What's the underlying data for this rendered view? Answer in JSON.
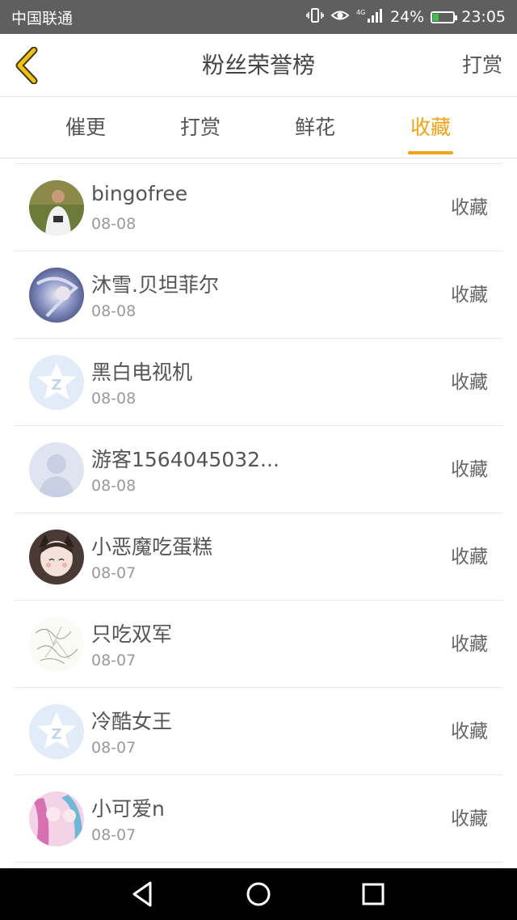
{
  "status_bar": {
    "carrier": "中国联通",
    "network": "4G",
    "battery": "24%",
    "time": "23:05",
    "icons": [
      "vibrate-icon",
      "eye-icon",
      "signal-icon",
      "battery-icon"
    ]
  },
  "header": {
    "title": "粉丝荣誉榜",
    "right_action": "打赏",
    "back_icon": "chevron-left-icon"
  },
  "tabs": [
    {
      "label": "催更",
      "active": false
    },
    {
      "label": "打赏",
      "active": false
    },
    {
      "label": "鲜花",
      "active": false
    },
    {
      "label": "收藏",
      "active": true
    }
  ],
  "list": [
    {
      "name": "bingofree",
      "date": "08-08",
      "action": "收藏",
      "avatar": "photo-avatar"
    },
    {
      "name": "沐雪.贝坦菲尔",
      "date": "08-08",
      "action": "收藏",
      "avatar": "anime-avatar"
    },
    {
      "name": "黑白电视机",
      "date": "08-08",
      "action": "收藏",
      "avatar": "qzone-default-avatar"
    },
    {
      "name": "游客1564045032...",
      "date": "08-08",
      "action": "收藏",
      "avatar": "default-person-avatar"
    },
    {
      "name": "小恶魔吃蛋糕",
      "date": "08-07",
      "action": "收藏",
      "avatar": "anime-avatar"
    },
    {
      "name": "只吃双军",
      "date": "08-07",
      "action": "收藏",
      "avatar": "sketch-avatar"
    },
    {
      "name": "冷酷女王",
      "date": "08-07",
      "action": "收藏",
      "avatar": "qzone-default-avatar"
    },
    {
      "name": "小可爱n",
      "date": "08-07",
      "action": "收藏",
      "avatar": "anime-avatar"
    }
  ],
  "colors": {
    "accent": "#f3a317",
    "status_bar_bg": "#5f5f5f",
    "nav_bar_bg": "#000000",
    "battery_fill": "#3cc24a"
  }
}
